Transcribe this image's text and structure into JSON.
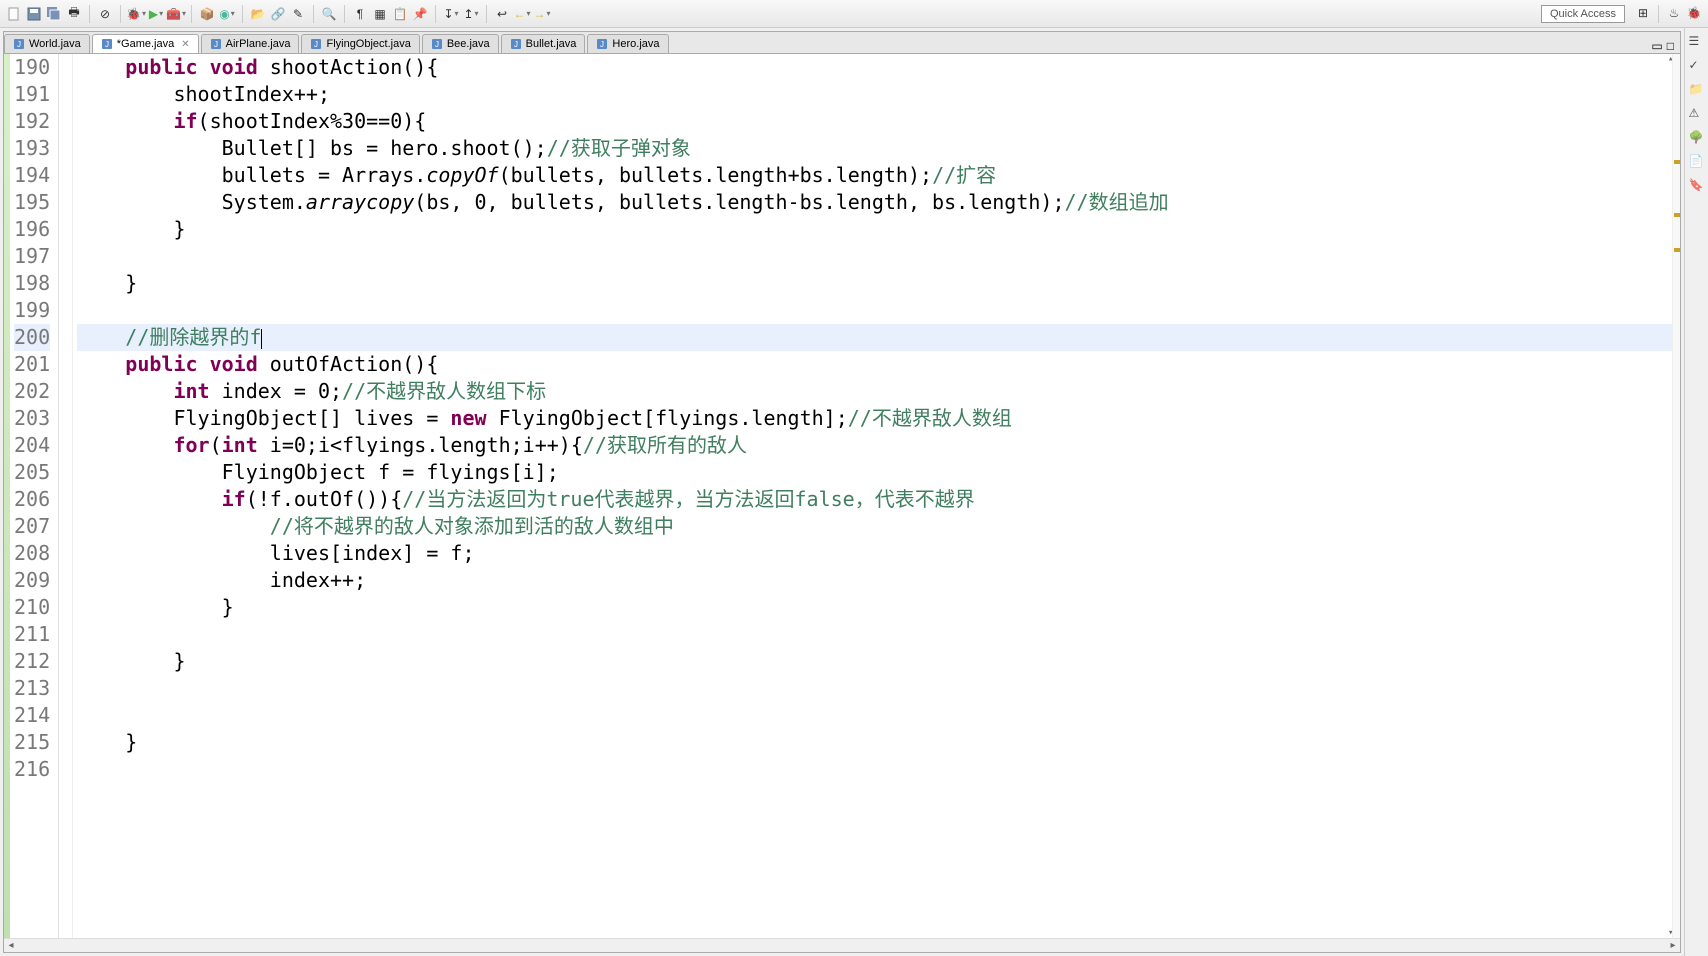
{
  "quick_access": "Quick Access",
  "tabs": [
    {
      "label": "World.java",
      "active": false,
      "dirty": false,
      "closeable": false
    },
    {
      "label": "*Game.java",
      "active": true,
      "dirty": true,
      "closeable": true
    },
    {
      "label": "AirPlane.java",
      "active": false,
      "dirty": false,
      "closeable": false
    },
    {
      "label": "FlyingObject.java",
      "active": false,
      "dirty": false,
      "closeable": false
    },
    {
      "label": "Bee.java",
      "active": false,
      "dirty": false,
      "closeable": false
    },
    {
      "label": "Bullet.java",
      "active": false,
      "dirty": false,
      "closeable": false
    },
    {
      "label": "Hero.java",
      "active": false,
      "dirty": false,
      "closeable": false
    }
  ],
  "line_start": 190,
  "line_end": 216,
  "current_line": 200,
  "code_lines": [
    {
      "n": 190,
      "html": "    <span class='kw'>public void</span> shootAction(){"
    },
    {
      "n": 191,
      "html": "        shootIndex++;"
    },
    {
      "n": 192,
      "html": "        <span class='kw'>if</span>(shootIndex%30==0){"
    },
    {
      "n": 193,
      "html": "            Bullet[] bs = hero.shoot();<span class='cm'>//获取子弹对象</span>"
    },
    {
      "n": 194,
      "html": "            bullets = Arrays.<span class='it'>copyOf</span>(bullets, bullets.length+bs.length);<span class='cm'>//扩容</span>"
    },
    {
      "n": 195,
      "html": "            System.<span class='it'>arraycopy</span>(bs, 0, bullets, bullets.length-bs.length, bs.length);<span class='cm'>//数组追加</span>"
    },
    {
      "n": 196,
      "html": "        }"
    },
    {
      "n": 197,
      "html": ""
    },
    {
      "n": 198,
      "html": "    }"
    },
    {
      "n": 199,
      "html": ""
    },
    {
      "n": 200,
      "html": "    <span class='cm'>//删除越界的f</span><span class='cursor'></span>"
    },
    {
      "n": 201,
      "html": "    <span class='kw'>public void</span> outOfAction(){"
    },
    {
      "n": 202,
      "html": "        <span class='kw'>int</span> index = 0;<span class='cm'>//不越界敌人数组下标</span>"
    },
    {
      "n": 203,
      "html": "        FlyingObject[] lives = <span class='kw'>new</span> FlyingObject[flyings.length];<span class='cm'>//不越界敌人数组</span>"
    },
    {
      "n": 204,
      "html": "        <span class='kw'>for</span>(<span class='kw'>int</span> i=0;i&lt;flyings.length;i++){<span class='cm'>//获取所有的敌人</span>"
    },
    {
      "n": 205,
      "html": "            FlyingObject f = flyings[i];"
    },
    {
      "n": 206,
      "html": "            <span class='kw'>if</span>(!f.outOf()){<span class='cm'>//当方法返回为true代表越界，当方法返回false，代表不越界</span>"
    },
    {
      "n": 207,
      "html": "                <span class='cm'>//将不越界的敌人对象添加到活的敌人数组中</span>"
    },
    {
      "n": 208,
      "html": "                lives[index] = f;"
    },
    {
      "n": 209,
      "html": "                index++;"
    },
    {
      "n": 210,
      "html": "            }"
    },
    {
      "n": 211,
      "html": ""
    },
    {
      "n": 212,
      "html": "        }"
    },
    {
      "n": 213,
      "html": ""
    },
    {
      "n": 214,
      "html": ""
    },
    {
      "n": 215,
      "html": "    }"
    },
    {
      "n": 216,
      "html": ""
    }
  ],
  "toolbar_icons": [
    "new",
    "save",
    "save-all",
    "print",
    "build",
    "debug-dd",
    "run-dd",
    "ext-tools-dd",
    "new-pkg",
    "refresh-dd",
    "open-type",
    "open-task",
    "open-resource",
    "search",
    "toggle-mark",
    "toggle-block",
    "toggle-ws",
    "next-ann-dd",
    "prev-ann-dd",
    "last-edit",
    "back-dd",
    "forward-dd"
  ],
  "right_strip_icons": [
    "outline",
    "task-list",
    "bookmarks",
    "problems",
    "call-hierarchy",
    "type-hierarchy",
    "templates"
  ]
}
